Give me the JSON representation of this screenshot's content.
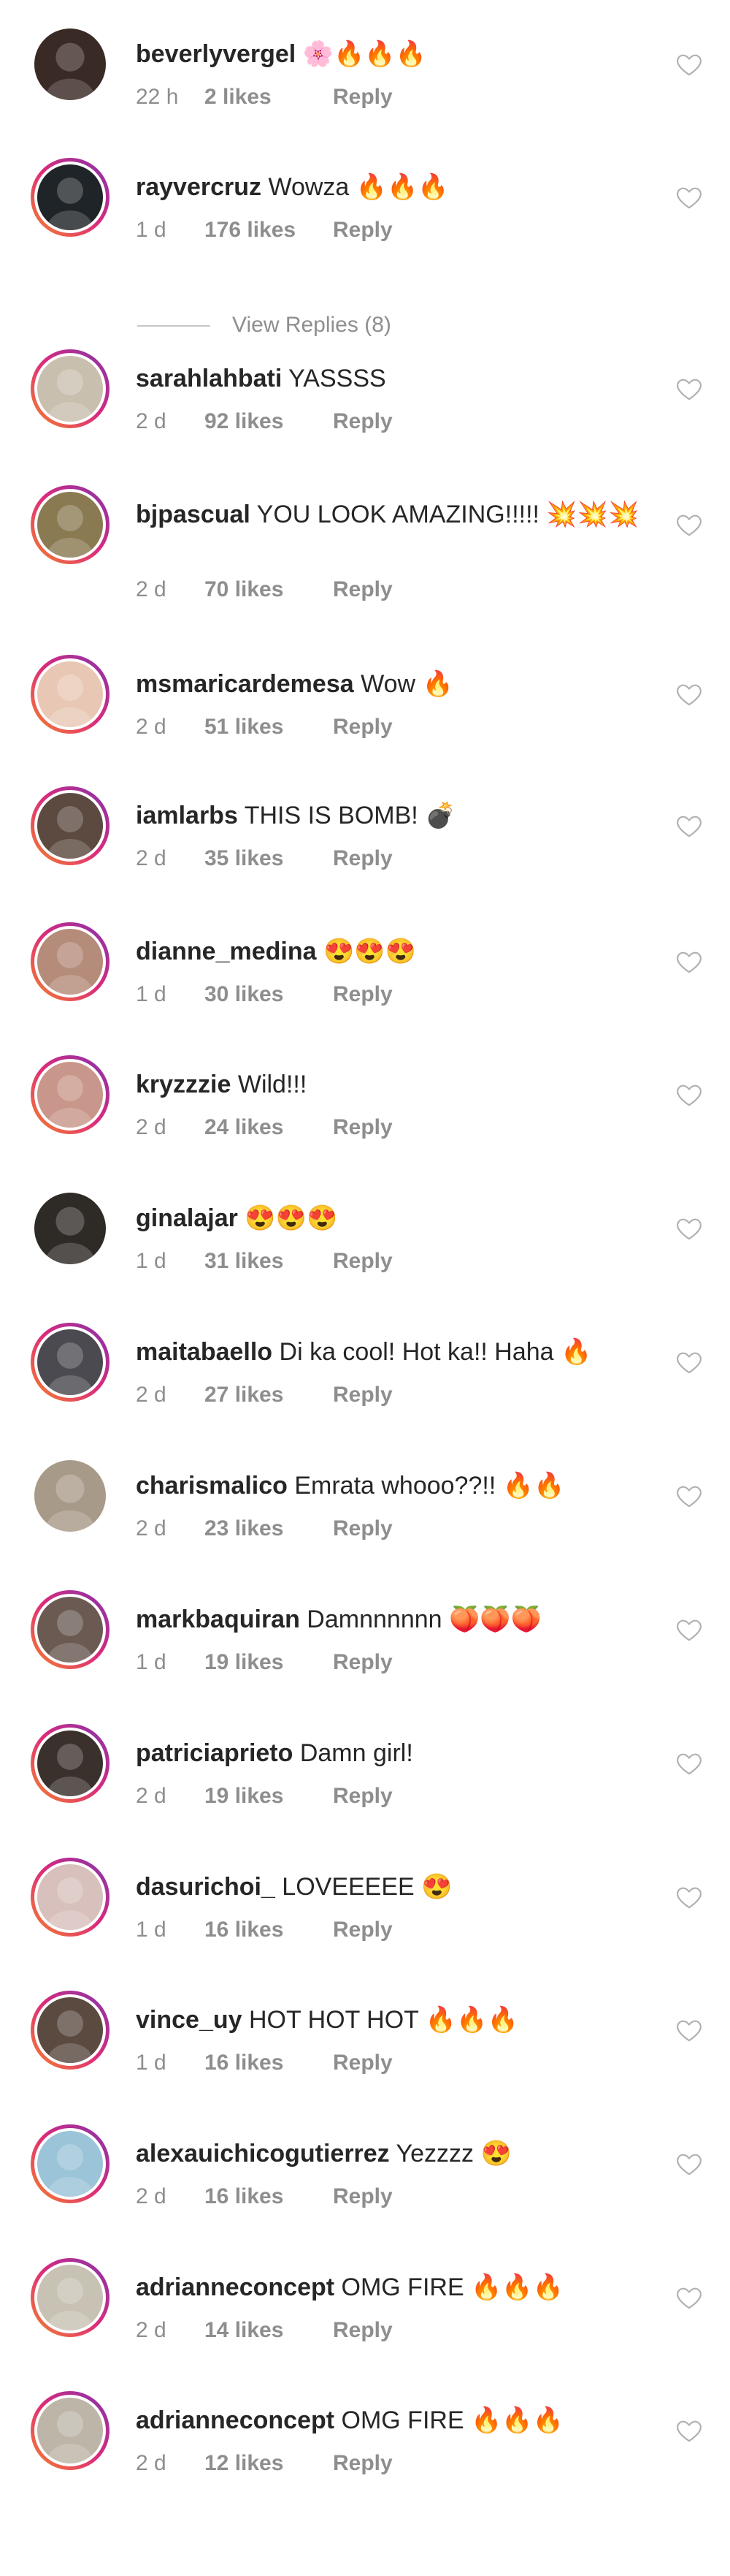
{
  "like_label": "likes",
  "reply_label": "Reply",
  "view_replies": "View Replies (8)",
  "comments": [
    {
      "user": "beverlyvergel",
      "text": "",
      "emoji": [
        "🌸",
        "🔥",
        "🔥",
        "🔥"
      ],
      "time": "22 h",
      "likes": "2",
      "ring": false,
      "avatar_color": "#3a2a25"
    },
    {
      "user": "rayvercruz",
      "text": "Wowza",
      "emoji": [
        "🔥",
        "🔥",
        "🔥"
      ],
      "time": "1 d",
      "likes": "176",
      "ring": true,
      "avatar_color": "#1f2428"
    },
    {
      "user": "sarahlahbati",
      "text": "YASSSS",
      "emoji": [],
      "time": "2 d",
      "likes": "92",
      "ring": true,
      "avatar_color": "#c9bfae"
    },
    {
      "user": "bjpascual",
      "text": "YOU LOOK AMAZING!!!!!",
      "emoji": [
        "💥",
        "💥",
        "💥"
      ],
      "time": "2 d",
      "likes": "70",
      "ring": true,
      "avatar_color": "#8a7a52"
    },
    {
      "user": "msmaricardemesa",
      "text": "Wow",
      "emoji": [
        "🔥"
      ],
      "time": "2 d",
      "likes": "51",
      "ring": true,
      "avatar_color": "#e8c8b5"
    },
    {
      "user": "iamlarbs",
      "text": "THIS IS BOMB!",
      "emoji": [
        "💣"
      ],
      "time": "2 d",
      "likes": "35",
      "ring": true,
      "avatar_color": "#5c4a40"
    },
    {
      "user": "dianne_medina",
      "text": "",
      "emoji": [
        "😍",
        "😍",
        "😍"
      ],
      "time": "1 d",
      "likes": "30",
      "ring": true,
      "avatar_color": "#b58b7a"
    },
    {
      "user": "kryzzzie",
      "text": "Wild!!!",
      "emoji": [],
      "time": "2 d",
      "likes": "24",
      "ring": true,
      "avatar_color": "#c8968a"
    },
    {
      "user": "ginalajar",
      "text": "",
      "emoji": [
        "😍",
        "😍",
        "😍"
      ],
      "time": "1 d",
      "likes": "31",
      "ring": false,
      "avatar_color": "#2e2a26"
    },
    {
      "user": "maitabaello",
      "text": "Di ka cool! Hot ka!! Haha",
      "emoji": [
        "🔥"
      ],
      "time": "2 d",
      "likes": "27",
      "ring": true,
      "avatar_color": "#4a4a50"
    },
    {
      "user": "charismalico",
      "text": "Emrata whooo??!!",
      "emoji": [
        "🔥",
        "🔥"
      ],
      "time": "2 d",
      "likes": "23",
      "ring": false,
      "avatar_color": "#a89a88"
    },
    {
      "user": "markbaquiran",
      "text": "Damnnnnnn",
      "emoji": [
        "🍑",
        "🍑",
        "🍑"
      ],
      "time": "1 d",
      "likes": "19",
      "ring": true,
      "avatar_color": "#6a5a52"
    },
    {
      "user": "patriciaprieto",
      "text": "Damn girl!",
      "emoji": [],
      "time": "2 d",
      "likes": "19",
      "ring": true,
      "avatar_color": "#3a302c"
    },
    {
      "user": "dasurichoi_",
      "text": "LOVEEEEE",
      "emoji": [
        "😍"
      ],
      "time": "1 d",
      "likes": "16",
      "ring": true,
      "avatar_color": "#d8c0bc"
    },
    {
      "user": "vince_uy",
      "text": "HOT HOT HOT",
      "emoji": [
        "🔥",
        "🔥",
        "🔥"
      ],
      "time": "1 d",
      "likes": "16",
      "ring": true,
      "avatar_color": "#5a4a40"
    },
    {
      "user": "alexauichicogutierrez",
      "text": "Yezzzz",
      "emoji": [
        "😍"
      ],
      "time": "2 d",
      "likes": "16",
      "ring": true,
      "avatar_color": "#9cc4d8"
    },
    {
      "user": "adrianneconcept",
      "text": "OMG FIRE",
      "emoji": [
        "🔥",
        "🔥",
        "🔥"
      ],
      "time": "2 d",
      "likes": "14",
      "ring": true,
      "avatar_color": "#c8c2b4"
    },
    {
      "user": "adrianneconcept",
      "text": "OMG FIRE",
      "emoji": [
        "🔥",
        "🔥",
        "🔥"
      ],
      "time": "2 d",
      "likes": "12",
      "ring": true,
      "avatar_color": "#bdb6a8"
    }
  ],
  "icons": {
    "heart": "heart-outline-icon"
  }
}
